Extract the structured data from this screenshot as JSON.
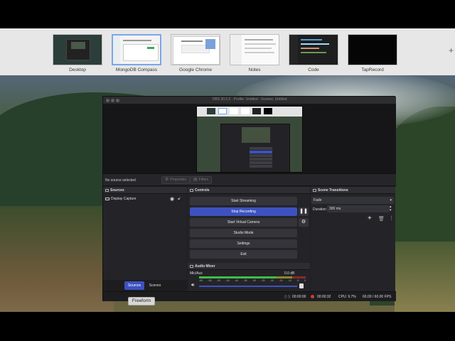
{
  "spaces": [
    {
      "label": "Desktop"
    },
    {
      "label": "MongoDB Compass"
    },
    {
      "label": "Google Chrome"
    },
    {
      "label": "Notes"
    },
    {
      "label": "Code"
    },
    {
      "label": "TapRecord"
    }
  ],
  "add_space_label": "+",
  "obs": {
    "title": "OBS 30.0.2 - Profile: Untitled - Scenes: Untitled",
    "no_source": "No source selected",
    "properties_label": "Properties",
    "filters_label": "Filters",
    "sources_title": "Sources",
    "source_item": "Display Capture",
    "tab_sources": "Sources",
    "tab_scenes": "Scenes",
    "controls_title": "Controls",
    "controls": {
      "start_streaming": "Start Streaming",
      "stop_recording": "Stop Recording",
      "start_virtual_camera": "Start Virtual Camera",
      "studio_mode": "Studio Mode",
      "settings": "Settings",
      "exit": "Exit"
    },
    "mixer_title": "Audio Mixer",
    "mixer_channel": "Mic/Aux",
    "mixer_db": "0.0 dB",
    "mixer_scale": [
      "-60",
      "-55",
      "-50",
      "-45",
      "-40",
      "-35",
      "-30",
      "-25",
      "-20",
      "-15",
      "-10",
      "-5",
      "0"
    ],
    "mixer_level": 0.72,
    "transitions_title": "Scene Transitions",
    "transition": "Fade",
    "duration_label": "Duration",
    "duration_value": "300 ms",
    "status": {
      "stream_time": "00:00:00",
      "rec_time": "00:00:32",
      "cpu": "CPU: 9.7%",
      "fps": "60.00 / 60.00 FPS"
    }
  },
  "tooltip": "Freeform",
  "colors": {
    "accent": "#3d52c0",
    "recording": "#d23a3a"
  }
}
